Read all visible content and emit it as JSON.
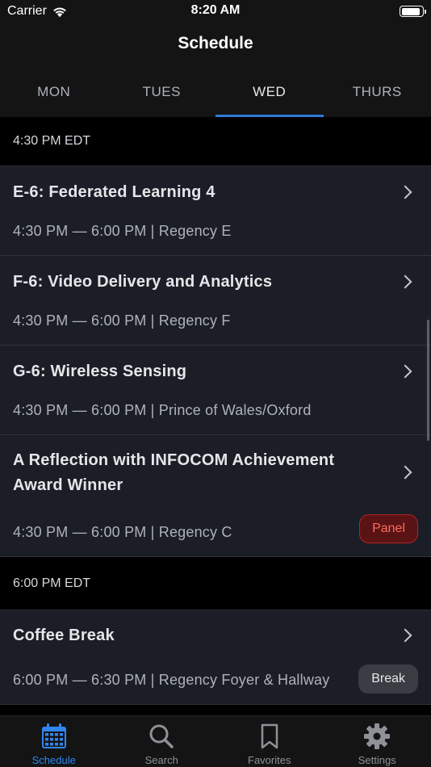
{
  "status_bar": {
    "carrier": "Carrier",
    "time": "8:20 AM",
    "battery_level": 0.95
  },
  "nav": {
    "title": "Schedule"
  },
  "day_tabs": [
    {
      "label": "MON",
      "active": false
    },
    {
      "label": "TUES",
      "active": false
    },
    {
      "label": "WED",
      "active": true
    },
    {
      "label": "THURS",
      "active": false
    }
  ],
  "sections": [
    {
      "header": "4:30 PM EDT",
      "sessions": [
        {
          "title": "E-6: Federated Learning 4",
          "subtitle": "4:30 PM — 6:00 PM | Regency E",
          "badge": ""
        },
        {
          "title": "F-6: Video Delivery and Analytics",
          "subtitle": "4:30 PM — 6:00 PM | Regency F",
          "badge": ""
        },
        {
          "title": "G-6: Wireless Sensing",
          "subtitle": "4:30 PM — 6:00 PM | Prince of Wales/Oxford",
          "badge": ""
        },
        {
          "title": "A Reflection with INFOCOM Achievement Award Winner",
          "subtitle": "4:30 PM — 6:00 PM | Regency C",
          "badge": "Panel"
        }
      ]
    },
    {
      "header": "6:00 PM EDT",
      "sessions": [
        {
          "title": "Coffee Break",
          "subtitle": "6:00 PM — 6:30 PM | Regency Foyer & Hallway",
          "badge": "Break"
        }
      ]
    }
  ],
  "bottom_tabs": [
    {
      "label": "Schedule",
      "icon": "calendar-icon",
      "active": true
    },
    {
      "label": "Search",
      "icon": "search-icon",
      "active": false
    },
    {
      "label": "Favorites",
      "icon": "bookmark-icon",
      "active": false
    },
    {
      "label": "Settings",
      "icon": "gear-icon",
      "active": false
    }
  ],
  "colors": {
    "accent": "#2f7bd9",
    "panel_badge": "#ff6a5c",
    "row_background": "#1b1e27"
  }
}
